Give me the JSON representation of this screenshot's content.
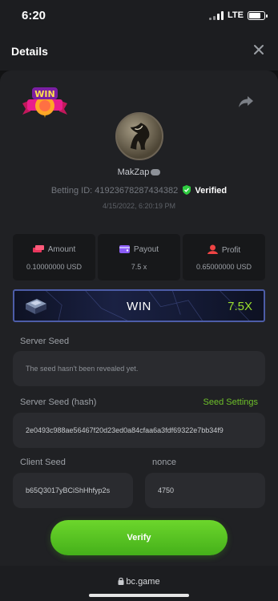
{
  "status": {
    "time": "6:20",
    "network": "LTE"
  },
  "header": {
    "title": "Details"
  },
  "badge": {
    "text": "WIN"
  },
  "player": {
    "username": "MakZap",
    "betting_id_label": "Betting ID:",
    "betting_id": "41923678287434382",
    "verified_label": "Verified",
    "timestamp": "4/15/2022, 6:20:19 PM"
  },
  "stats": [
    {
      "icon": "money-stack-icon",
      "label": "Amount",
      "value": "0.10000000 USD"
    },
    {
      "icon": "wallet-icon",
      "label": "Payout",
      "value": "7.5 x"
    },
    {
      "icon": "profit-icon",
      "label": "Profit",
      "value": "0.65000000 USD"
    }
  ],
  "banner": {
    "label": "WIN",
    "multiplier": "7.5X"
  },
  "server_seed": {
    "label": "Server Seed",
    "value": "The seed hasn't been revealed yet."
  },
  "server_seed_hash": {
    "label": "Server Seed (hash)",
    "settings_link": "Seed Settings",
    "value": "2e0493c988ae56467f20d23ed0a84cfaa6a3fdf69322e7bb34f9"
  },
  "client_seed": {
    "label": "Client Seed",
    "value": "b65Q3017yBCiShHhfyp2s"
  },
  "nonce": {
    "label": "nonce",
    "value": "4750"
  },
  "verify": {
    "label": "Verify"
  },
  "browser": {
    "url": "bc.game"
  },
  "colors": {
    "accent_green": "#6ec02a",
    "verified_green": "#2ecc40",
    "multiplier_green": "#9adf2d"
  }
}
